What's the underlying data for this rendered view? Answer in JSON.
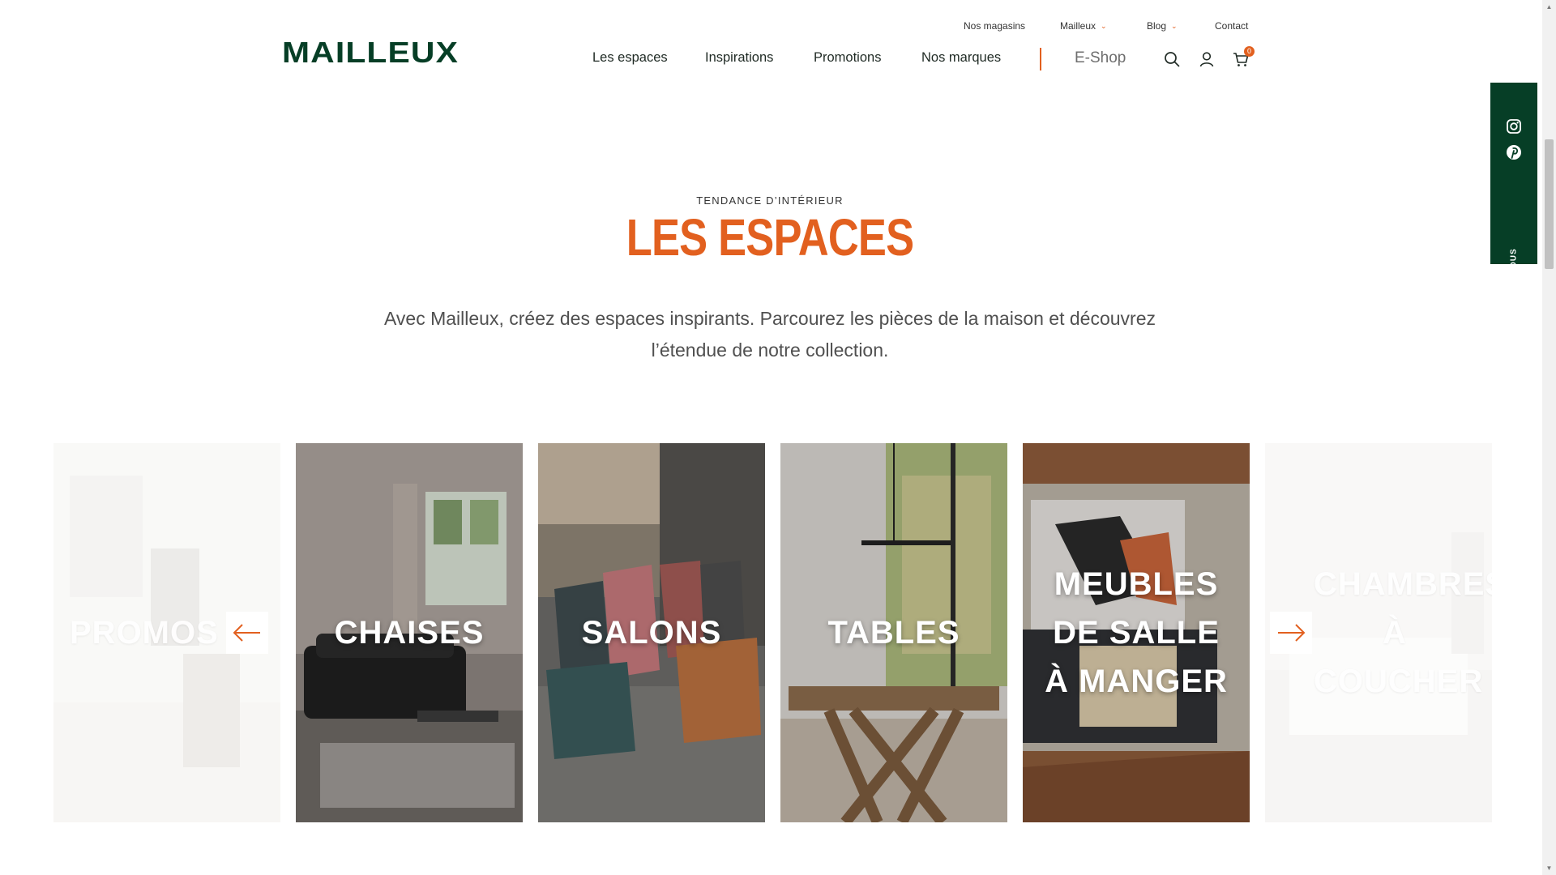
{
  "brand": {
    "logo_text": "MAILLEUX",
    "colors": {
      "accent": "#e2601f",
      "dark_green": "#063e26",
      "text": "#1f2a24"
    }
  },
  "top_links": [
    {
      "label": "Nos magasins",
      "dropdown": false
    },
    {
      "label": "Mailleux",
      "dropdown": true
    },
    {
      "label": "Blog",
      "dropdown": true
    },
    {
      "label": "Contact",
      "dropdown": false
    }
  ],
  "main_nav": [
    {
      "label": "Les espaces"
    },
    {
      "label": "Inspirations"
    },
    {
      "label": "Promotions"
    },
    {
      "label": "Nos marques"
    }
  ],
  "eshop_label": "E-Shop",
  "header_icons": [
    "search-icon",
    "user-icon",
    "cart-icon"
  ],
  "cart_count": "0",
  "follow": {
    "label": "SUIVEZ-NOUS",
    "icons": [
      "instagram-icon",
      "pinterest-icon"
    ]
  },
  "section": {
    "eyebrow": "TENDANCE D’INTÉRIEUR",
    "title": "LES ESPACES",
    "intro": "Avec Mailleux, créez des espaces inspirants. Parcourez les pièces de la maison et découvrez l’étendue de notre collection."
  },
  "carousel": {
    "prev_icon": "arrow-left-icon",
    "next_icon": "arrow-right-icon",
    "cards": [
      {
        "label": "PROMOS",
        "faded": true
      },
      {
        "label": "CHAISES",
        "faded": false
      },
      {
        "label": "SALONS",
        "faded": false
      },
      {
        "label": "TABLES",
        "faded": false
      },
      {
        "label": "MEUBLES DE SALLE À MANGER",
        "faded": false
      },
      {
        "label": "CHAMBRES À COUCHER",
        "faded": true
      }
    ]
  }
}
